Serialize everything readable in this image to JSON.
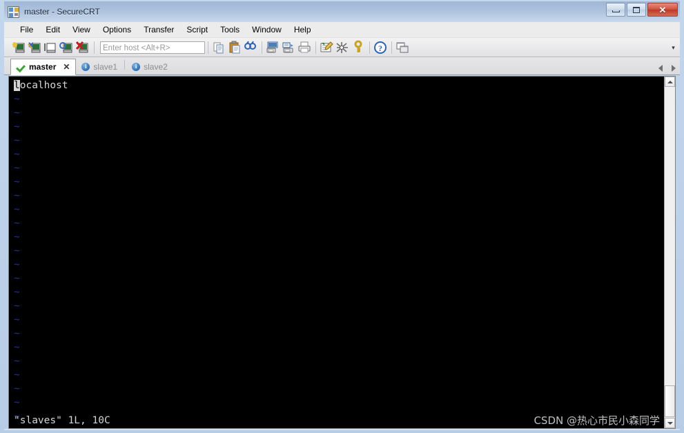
{
  "window": {
    "title": "master - SecureCRT",
    "icon": "securecrt-app-icon",
    "buttons": {
      "minimize": "minimize",
      "restore": "restore",
      "close": "✕"
    }
  },
  "menu": {
    "items": [
      {
        "label": "File"
      },
      {
        "label": "Edit"
      },
      {
        "label": "View"
      },
      {
        "label": "Options"
      },
      {
        "label": "Transfer"
      },
      {
        "label": "Script"
      },
      {
        "label": "Tools"
      },
      {
        "label": "Window"
      },
      {
        "label": "Help"
      }
    ]
  },
  "toolbar": {
    "icons": [
      {
        "name": "new-session-icon"
      },
      {
        "name": "connect-sftp-icon"
      },
      {
        "name": "connect-local-shell-icon"
      },
      {
        "name": "reconnect-icon"
      },
      {
        "name": "disconnect-icon"
      },
      {
        "name": "copy-icon"
      },
      {
        "name": "paste-icon"
      },
      {
        "name": "find-icon"
      },
      {
        "name": "print-screen-icon"
      },
      {
        "name": "log-session-icon"
      },
      {
        "name": "print-icon"
      },
      {
        "name": "session-options-icon"
      },
      {
        "name": "global-options-icon"
      },
      {
        "name": "key-icon"
      },
      {
        "name": "help-icon"
      },
      {
        "name": "arrange-windows-icon"
      }
    ],
    "host_input": {
      "value": "",
      "placeholder": "Enter host <Alt+R>"
    },
    "overflow": "▾"
  },
  "tabs": {
    "items": [
      {
        "label": "master",
        "icon": "green-check-icon",
        "active": true,
        "close": "✕"
      },
      {
        "label": "slave1",
        "icon": "blue-info-icon",
        "active": false
      },
      {
        "label": "slave2",
        "icon": "blue-info-icon",
        "active": false
      }
    ],
    "nav": {
      "prev": "scroll-tabs-left",
      "next": "scroll-tabs-right"
    }
  },
  "terminal": {
    "cursor_char": "l",
    "first_line_rest": "ocalhost",
    "tilde": "~",
    "tilde_count": 24,
    "status_line": "\"slaves\" 1L, 10C",
    "watermark": "CSDN @热心市民小森同学",
    "colors": {
      "background": "#000000",
      "foreground": "#d6d6d6",
      "tilde": "#2222e0"
    }
  },
  "scrollbar": {
    "up": "scroll-up",
    "down": "scroll-down",
    "thumb": "scroll-thumb"
  }
}
